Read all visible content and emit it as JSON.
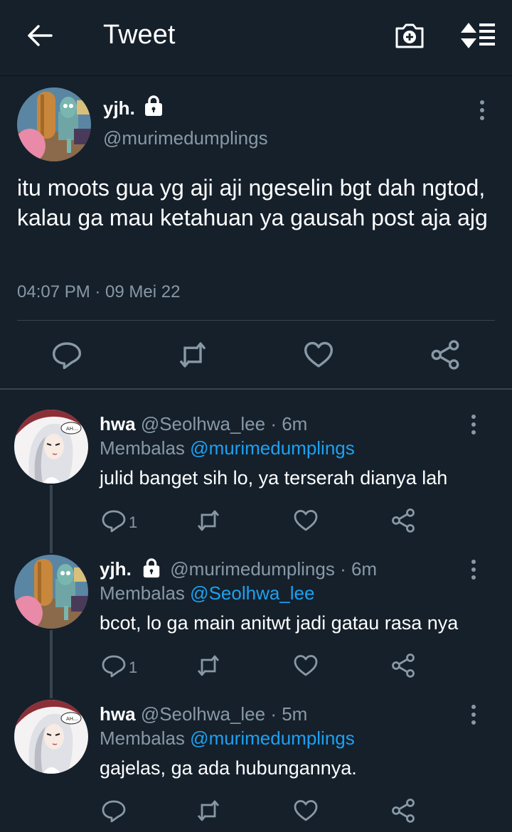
{
  "header": {
    "title": "Tweet"
  },
  "colors": {
    "background": "#15202b",
    "muted": "#8899a6",
    "accent": "#1da1f2",
    "divider": "#38444d"
  },
  "icons": {
    "back": "back-arrow-icon",
    "camera": "camera-add-icon",
    "sort": "sort-icon",
    "lock": "lock-icon",
    "more": "more-vertical-icon",
    "reply": "reply-icon",
    "retweet": "retweet-icon",
    "like": "heart-icon",
    "share": "share-icon"
  },
  "tweet": {
    "name": "yjh.",
    "handle": "@murimedumplings",
    "text": "itu moots gua yg aji aji ngeselin bgt dah ngtod, kalau ga mau ketahuan ya gausah post aja ajg",
    "timestamp": "04:07 PM · 09 Mei 22"
  },
  "replies": [
    {
      "name": "hwa",
      "meta": "@Seolhwa_lee · 6m",
      "replying_label": "Membalas",
      "replying_to": "@murimedumplings",
      "text": "julid banget sih lo, ya terserah dianya lah",
      "reply_count": "1"
    },
    {
      "name": "yjh.",
      "meta": "@murimedumplings · 6m",
      "replying_label": "Membalas",
      "replying_to": "@Seolhwa_lee",
      "text": "bcot, lo ga main anitwt jadi gatau rasa nya",
      "reply_count": "1"
    },
    {
      "name": "hwa",
      "meta": "@Seolhwa_lee · 5m",
      "replying_label": "Membalas",
      "replying_to": "@murimedumplings",
      "text": "gajelas, ga ada hubungannya.",
      "reply_count": ""
    }
  ]
}
